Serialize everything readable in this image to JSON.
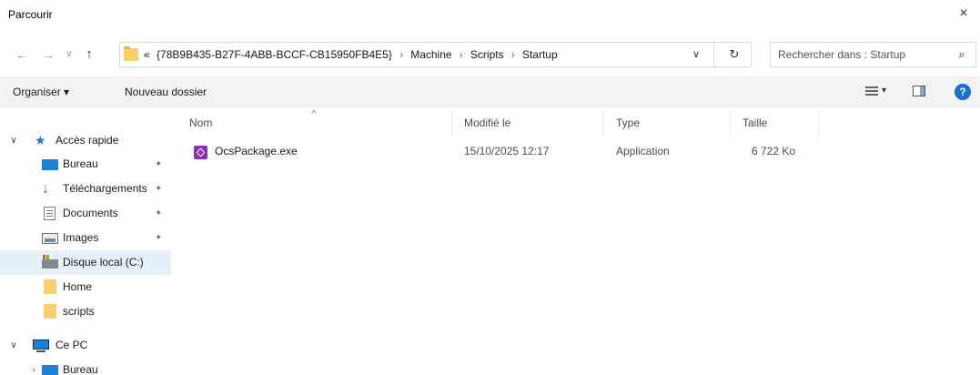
{
  "window": {
    "title": "Parcourir",
    "close_glyph": "×"
  },
  "nav": {
    "back_glyph": "←",
    "forward_glyph": "→",
    "history_glyph": "∨",
    "up_glyph": "↑",
    "breadcrumb": [
      "«",
      "{78B9B435-B27F-4ABB-BCCF-CB15950FB4E5}",
      "Machine",
      "Scripts",
      "Startup"
    ],
    "breadcrumb_separator": "›",
    "address_dropdown_glyph": "∨",
    "refresh_glyph": "↻",
    "search_placeholder": "Rechercher dans : Startup",
    "search_glyph": "⌕"
  },
  "toolbar": {
    "organize_label": "Organiser ▾",
    "new_folder_label": "Nouveau dossier",
    "view_dropdown_glyph": "▾",
    "help_glyph": "?"
  },
  "sidebar": {
    "items": [
      {
        "label": "Accès rapide",
        "icon": "star-icon",
        "chevron": "∨",
        "pinned": false
      },
      {
        "label": "Bureau",
        "icon": "desktop-icon",
        "chevron": "",
        "pinned": true
      },
      {
        "label": "Téléchargements",
        "icon": "download-icon",
        "chevron": "",
        "pinned": true
      },
      {
        "label": "Documents",
        "icon": "documents-icon",
        "chevron": "",
        "pinned": true
      },
      {
        "label": "Images",
        "icon": "images-icon",
        "chevron": "",
        "pinned": true
      },
      {
        "label": "Disque local (C:)",
        "icon": "drive-icon",
        "chevron": "",
        "pinned": false
      },
      {
        "label": "Home",
        "icon": "folder-icon",
        "chevron": "",
        "pinned": false
      },
      {
        "label": "scripts",
        "icon": "folder-icon",
        "chevron": "",
        "pinned": false
      },
      {
        "label": "Ce PC",
        "icon": "pc-icon",
        "chevron": "∨",
        "pinned": false
      },
      {
        "label": "Bureau",
        "icon": "desktop-icon",
        "chevron": "›",
        "pinned": false
      }
    ],
    "pin_glyph": "📌",
    "selected_label": "Disque local (C:)"
  },
  "columns": {
    "name": "Nom",
    "modified": "Modifié le",
    "type": "Type",
    "size": "Taille",
    "sort_glyph": "^"
  },
  "files": [
    {
      "name": "OcsPackage.exe",
      "modified": "15/10/2025 12:17",
      "type": "Application",
      "size": "6 722 Ko",
      "icon": "application-icon"
    }
  ]
}
